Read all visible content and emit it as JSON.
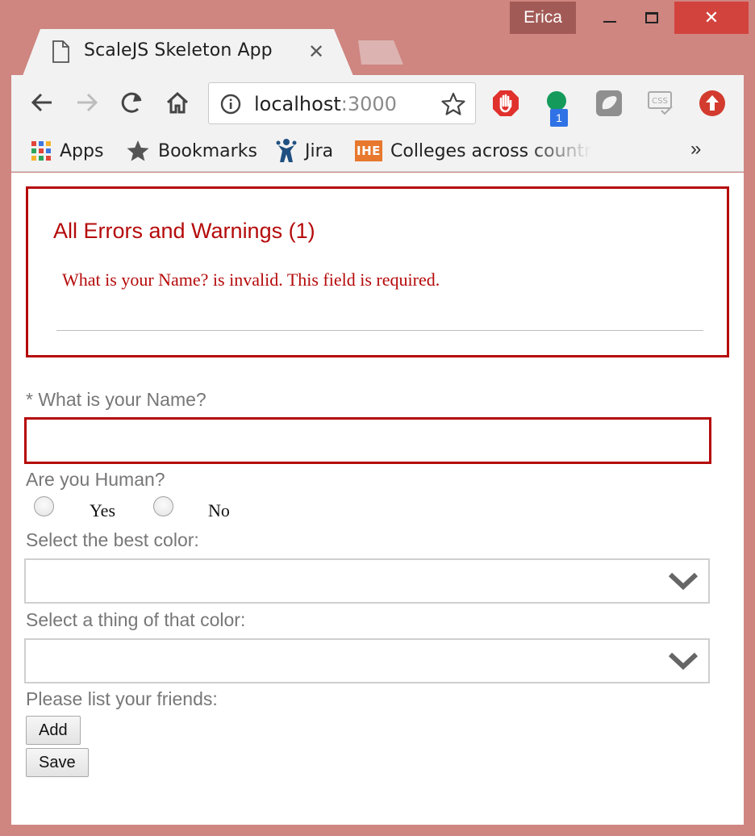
{
  "window": {
    "user": "Erica",
    "close_glyph": "✕"
  },
  "tab": {
    "title": "ScaleJS Skeleton App",
    "close_glyph": "✕"
  },
  "omnibox": {
    "host": "localhost",
    "port": ":3000"
  },
  "extensions": {
    "badge_count": "1",
    "css_label": "CSS"
  },
  "bookmarks": {
    "items": [
      {
        "label": "Apps",
        "icon": "apps-grid-icon"
      },
      {
        "label": "Bookmarks",
        "icon": "star-icon"
      },
      {
        "label": "Jira",
        "icon": "jira-icon"
      },
      {
        "label": "Colleges across countr",
        "icon": "ihe-icon",
        "icon_text": "IHE"
      }
    ],
    "more": "»"
  },
  "errors": {
    "title": "All Errors and Warnings (1)",
    "message": "What is your Name? is invalid. This field is required."
  },
  "form": {
    "name_label": "* What is your Name?",
    "name_value": "",
    "human_label": "Are you Human?",
    "human_options": [
      "Yes",
      "No"
    ],
    "color_label": "Select the best color:",
    "color_value": "",
    "thing_label": "Select a thing of that color:",
    "thing_value": "",
    "friends_label": "Please list your friends:",
    "add_label": "Add",
    "save_label": "Save"
  },
  "colors": {
    "error": "#b50a0a",
    "window_frame": "#cf8580",
    "close_button": "#d2433e"
  }
}
